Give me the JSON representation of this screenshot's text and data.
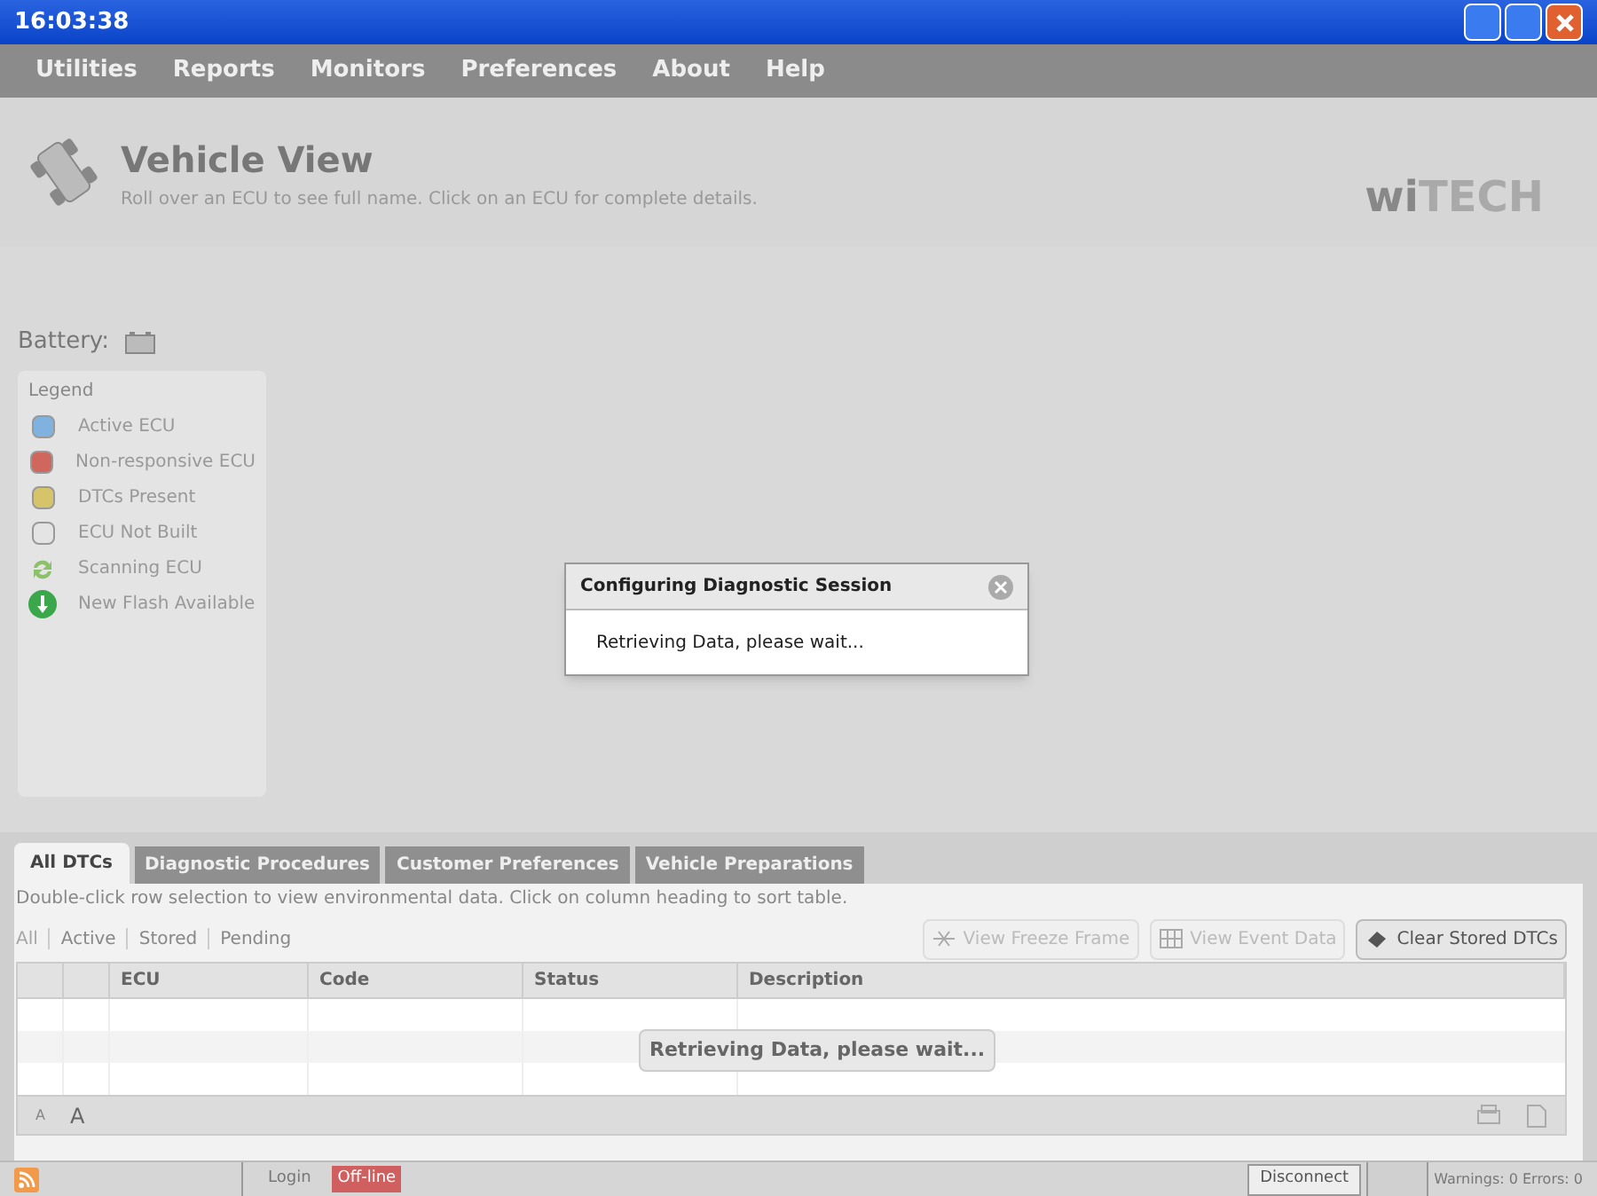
{
  "window": {
    "title": "16:03:38"
  },
  "menu": [
    "Utilities",
    "Reports",
    "Monitors",
    "Preferences",
    "About",
    "Help"
  ],
  "header": {
    "title": "Vehicle View",
    "subtitle": "Roll over an ECU to see full name. Click on an ECU for complete details.",
    "logo_bold": "wi",
    "logo_light": "TECH"
  },
  "battery": {
    "label": "Battery:"
  },
  "legend": {
    "title": "Legend",
    "items": [
      {
        "kind": "swatch",
        "color": "#7fb2de",
        "label": "Active ECU"
      },
      {
        "kind": "swatch",
        "color": "#d0675e",
        "label": "Non-responsive ECU"
      },
      {
        "kind": "swatch",
        "color": "#d6c46a",
        "label": "DTCs Present"
      },
      {
        "kind": "swatch",
        "color": "#e4e4e4",
        "label": "ECU Not Built"
      },
      {
        "kind": "scanning",
        "label": "Scanning ECU"
      },
      {
        "kind": "flash",
        "label": "New Flash Available"
      }
    ]
  },
  "dialog": {
    "title": "Configuring Diagnostic Session",
    "message": "Retrieving Data, please wait..."
  },
  "tabs": [
    {
      "label": "All DTCs",
      "selected": true
    },
    {
      "label": "Diagnostic Procedures",
      "selected": false
    },
    {
      "label": "Customer Preferences",
      "selected": false
    },
    {
      "label": "Vehicle Preparations",
      "selected": false
    }
  ],
  "hint": "Double-click row selection to view environmental data.  Click on column heading to sort table.",
  "filters": [
    {
      "label": "All",
      "selected": true
    },
    {
      "label": "Active",
      "selected": false
    },
    {
      "label": "Stored",
      "selected": false
    },
    {
      "label": "Pending",
      "selected": false
    }
  ],
  "actions": [
    {
      "label": "View Freeze Frame",
      "kind": "freeze",
      "disabled": true
    },
    {
      "label": "View Event Data",
      "kind": "event",
      "disabled": true
    },
    {
      "label": "Clear Stored DTCs",
      "kind": "clear",
      "disabled": false
    }
  ],
  "table": {
    "columns": [
      "ECU",
      "Code",
      "Status",
      "Description"
    ],
    "loading": "Retrieving Data, please wait..."
  },
  "font_buttons": [
    "A",
    "A"
  ],
  "status_bar": {
    "login": "Login",
    "connection": "Off-line",
    "disconnect": "Disconnect",
    "counts": "Warnings: 0 Errors: 0"
  }
}
